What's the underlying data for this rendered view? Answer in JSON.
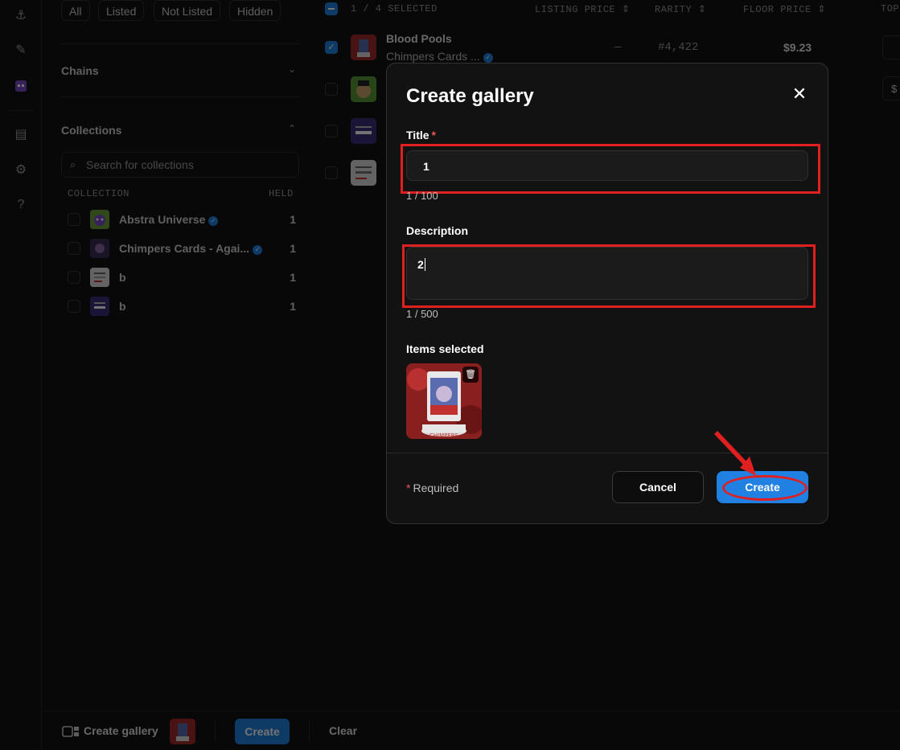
{
  "filters": {
    "pills": [
      "All",
      "Listed",
      "Not Listed",
      "Hidden"
    ],
    "chains_label": "Chains",
    "collections_label": "Collections",
    "search_placeholder": "Search for collections",
    "col_collection": "COLLECTION",
    "col_held": "HELD",
    "collections": [
      {
        "name": "Abstra Universe",
        "verified": true,
        "held": "1"
      },
      {
        "name": "Chimpers Cards - Agai...",
        "verified": true,
        "held": "1"
      },
      {
        "name": "b",
        "verified": false,
        "held": "1"
      },
      {
        "name": "b",
        "verified": false,
        "held": "1"
      }
    ]
  },
  "table": {
    "selected_text": "1 / 4 SELECTED",
    "col_listing_price": "LISTING PRICE",
    "col_rarity": "RARITY",
    "col_floor_price": "FLOOR PRICE",
    "col_top": "TOP",
    "row1": {
      "name": "Blood Pools",
      "collection": "Chimpers Cards ...",
      "listing_price": "—",
      "rarity": "#4,422",
      "floor_price": "$9.23"
    },
    "edge_btn": "$"
  },
  "bottom_bar": {
    "create_gallery_label": "Create gallery",
    "create_label": "Create",
    "clear_label": "Clear"
  },
  "modal": {
    "title": "Create gallery",
    "close_icon": "close-icon",
    "title_label": "Title",
    "title_value": "1",
    "title_counter": "1 / 100",
    "description_label": "Description",
    "description_value": "2",
    "description_counter": "1 / 500",
    "items_label": "Items selected",
    "required_note": "Required",
    "required_star": "*",
    "cancel_label": "Cancel",
    "create_label": "Create"
  },
  "colors": {
    "accent": "#2081e2",
    "highlight": "#e02020",
    "required": "#eb5757"
  }
}
